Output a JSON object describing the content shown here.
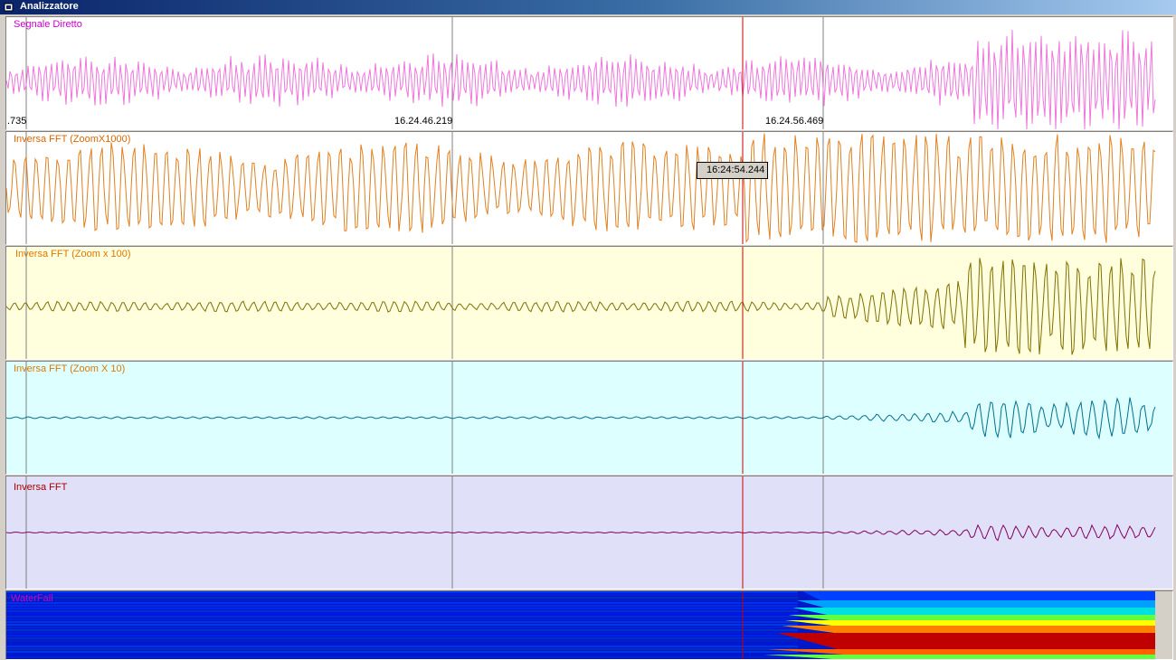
{
  "window": {
    "title": "Analizzatore"
  },
  "panels": [
    {
      "id": "segnale",
      "label": "Segnale Diretto",
      "label_color": "#cc00cc",
      "bg": "#ffffff",
      "wave_color": "#ee77dd"
    },
    {
      "id": "zoom1000",
      "label": "Inversa FFT (ZoomX1000)",
      "label_color": "#dd6600",
      "bg": "#ffffff",
      "wave_color": "#e08020"
    },
    {
      "id": "zoom100",
      "label": "Inversa FFT (Zoom x 100)",
      "label_color": "#dd7700",
      "bg": "#ffffdd",
      "wave_color": "#807000"
    },
    {
      "id": "zoom10",
      "label": "Inversa FFT (Zoom X 10)",
      "label_color": "#dd7700",
      "bg": "#ddffff",
      "wave_color": "#007090"
    },
    {
      "id": "fft",
      "label": "Inversa FFT",
      "label_color": "#aa0000",
      "bg": "#e0e0f8",
      "wave_color": "#800060"
    },
    {
      "id": "waterfall",
      "label": "WaterFall",
      "label_color": "#cc00cc"
    }
  ],
  "timestamps": {
    "left": ".735",
    "mid": "16.24.46.219",
    "right": "16.24.56.469"
  },
  "cursor": {
    "tooltip": "16:24:54.244",
    "color": "#cc0000"
  },
  "gridline_color": "#808080"
}
